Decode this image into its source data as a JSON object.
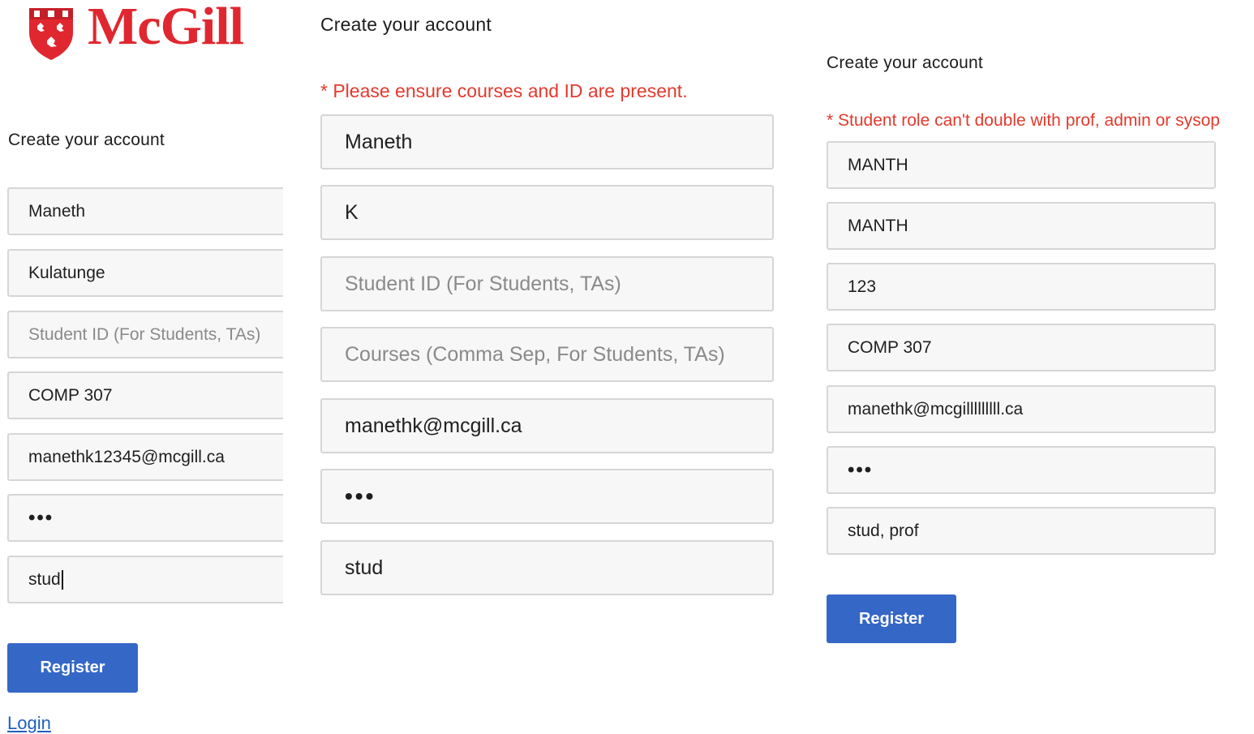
{
  "brand": {
    "logo_text": "McGill",
    "color": "#e0272f"
  },
  "col1": {
    "heading": "Create your account",
    "fields": [
      {
        "value": "Maneth",
        "placeholder": ""
      },
      {
        "value": "Kulatunge",
        "placeholder": ""
      },
      {
        "value": "",
        "placeholder": "Student ID (For Students, TAs)"
      },
      {
        "value": "COMP 307",
        "placeholder": ""
      },
      {
        "value": "manethk12345@mcgill.ca",
        "placeholder": ""
      },
      {
        "value": "•••",
        "placeholder": ""
      },
      {
        "value": "stud",
        "placeholder": ""
      }
    ],
    "register_label": "Register",
    "login_label": "Login"
  },
  "col2": {
    "heading": "Create your account",
    "error": "* Please ensure courses and ID are present.",
    "fields": [
      {
        "value": "Maneth",
        "placeholder": ""
      },
      {
        "value": "K",
        "placeholder": ""
      },
      {
        "value": "",
        "placeholder": "Student ID (For Students, TAs)"
      },
      {
        "value": "",
        "placeholder": "Courses (Comma Sep, For Students, TAs)"
      },
      {
        "value": "manethk@mcgill.ca",
        "placeholder": ""
      },
      {
        "value": "•••",
        "placeholder": ""
      },
      {
        "value": "stud",
        "placeholder": ""
      }
    ]
  },
  "col3": {
    "heading": "Create your account",
    "error": "* Student role can't double with prof, admin or sysop",
    "fields": [
      {
        "value": "MANTH",
        "placeholder": ""
      },
      {
        "value": "MANTH",
        "placeholder": ""
      },
      {
        "value": "123",
        "placeholder": ""
      },
      {
        "value": "COMP 307",
        "placeholder": ""
      },
      {
        "value": "manethk@mcgilllllllll.ca",
        "placeholder": ""
      },
      {
        "value": "•••",
        "placeholder": ""
      },
      {
        "value": "stud, prof",
        "placeholder": ""
      }
    ],
    "register_label": "Register"
  },
  "colors": {
    "button": "#3567c7",
    "error": "#e23a2d",
    "link": "#1f5fbf"
  }
}
